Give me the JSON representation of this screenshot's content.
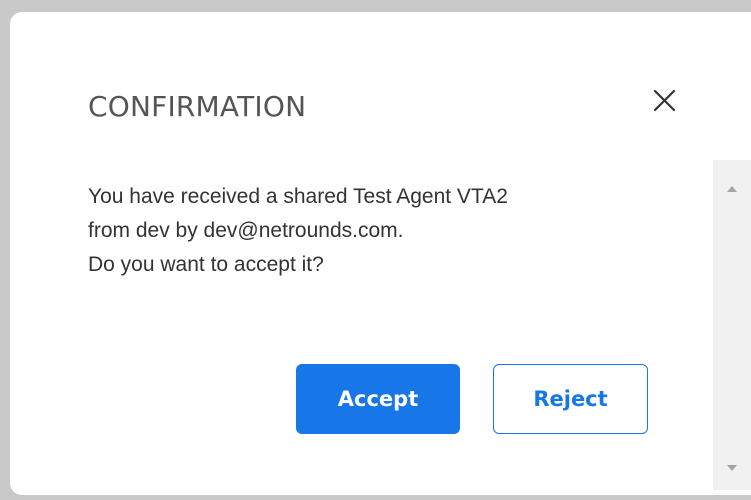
{
  "dialog": {
    "title": "CONFIRMATION",
    "close_icon": "close-icon",
    "message_lines": [
      "You have received a shared Test Agent VTA2",
      "from dev by dev@netrounds.com.",
      "Do you want to accept it?"
    ],
    "accept_label": "Accept",
    "reject_label": "Reject"
  },
  "scrollbar": {
    "up_icon": "scroll-up-arrow-icon",
    "down_icon": "scroll-down-arrow-icon"
  },
  "colors": {
    "accent": "#1877e8",
    "title_text": "#555555",
    "body_text": "#333333",
    "backdrop": "#c9c9c9",
    "surface": "#ffffff"
  }
}
